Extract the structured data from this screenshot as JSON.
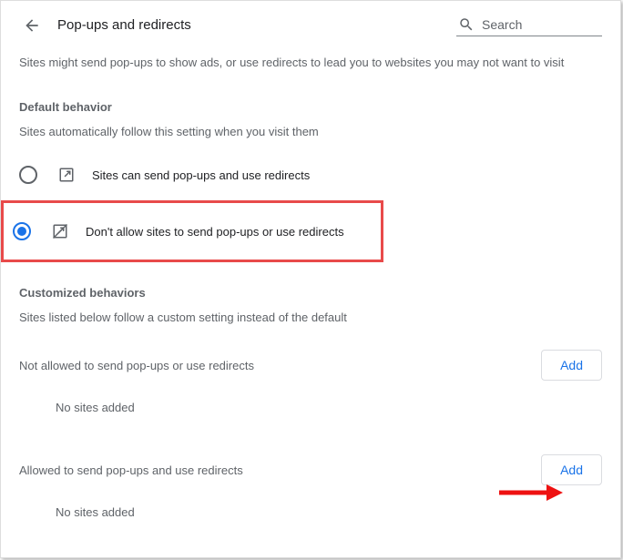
{
  "header": {
    "title": "Pop-ups and redirects",
    "search_placeholder": "Search"
  },
  "description": "Sites might send pop-ups to show ads, or use redirects to lead you to websites you may not want to visit",
  "default_behavior": {
    "title": "Default behavior",
    "subtitle": "Sites automatically follow this setting when you visit them",
    "options": [
      {
        "label": "Sites can send pop-ups and use redirects",
        "selected": false
      },
      {
        "label": "Don't allow sites to send pop-ups or use redirects",
        "selected": true
      }
    ]
  },
  "customized": {
    "title": "Customized behaviors",
    "subtitle": "Sites listed below follow a custom setting instead of the default"
  },
  "not_allowed": {
    "title": "Not allowed to send pop-ups or use redirects",
    "add_label": "Add",
    "empty_text": "No sites added"
  },
  "allowed": {
    "title": "Allowed to send pop-ups and use redirects",
    "add_label": "Add",
    "empty_text": "No sites added"
  }
}
